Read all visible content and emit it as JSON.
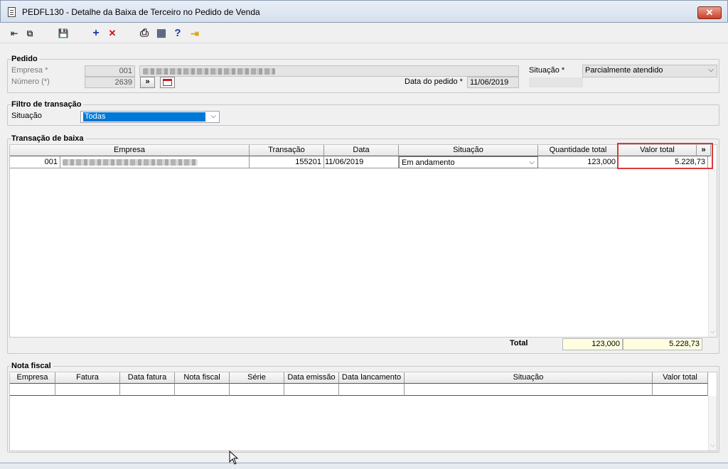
{
  "window": {
    "title": "PEDFL130 - Detalhe da Baixa de Terceiro no Pedido de Venda",
    "close": "✕"
  },
  "toolbar": {
    "items": [
      {
        "name": "navigate-back-icon",
        "glyph": "⇤"
      },
      {
        "name": "copy-icon",
        "glyph": "⧉"
      },
      {
        "name": "save-icon",
        "glyph": "💾"
      },
      {
        "name": "add-icon",
        "glyph": "+"
      },
      {
        "name": "delete-icon",
        "glyph": "✕"
      },
      {
        "name": "print-icon",
        "glyph": "⎙"
      },
      {
        "name": "calculator-icon",
        "glyph": "▦"
      },
      {
        "name": "help-icon",
        "glyph": "?"
      },
      {
        "name": "exit-icon",
        "glyph": "⇥"
      }
    ]
  },
  "pedido": {
    "title": "Pedido",
    "empresa_label": "Empresa *",
    "empresa_code": "001",
    "numero_label": "Número (*)",
    "numero_value": "2639",
    "nav_btn": "»",
    "data_label": "Data do pedido *",
    "data_value": "11/06/2019",
    "situacao_label": "Situação *",
    "situacao_value": "Parcialmente atendido"
  },
  "filtro": {
    "title": "Filtro de transação",
    "situacao_label": "Situação",
    "situacao_value": "Todas"
  },
  "transacao": {
    "title": "Transação de baixa",
    "headers": {
      "empresa": "Empresa",
      "transacao": "Transação",
      "data": "Data",
      "situacao": "Situação",
      "quantidade": "Quantidade total",
      "valor": "Valor total",
      "more": "»"
    },
    "row": {
      "empresa_code": "001",
      "transacao": "155201",
      "data": "11/06/2019",
      "situacao": "Em andamento",
      "quantidade": "123,000",
      "valor": "5.228,73"
    },
    "total_label": "Total",
    "total_quantidade": "123,000",
    "total_valor": "5.228,73"
  },
  "nota": {
    "title": "Nota fiscal",
    "headers": [
      "Empresa",
      "Fatura",
      "Data fatura",
      "Nota fiscal",
      "Série",
      "Data emissão",
      "Data lancamento",
      "Situação",
      "Valor total"
    ]
  },
  "colors": {
    "highlight": "#d93a3a",
    "selection": "#0078d7",
    "total_bg": "#ffffe0"
  }
}
